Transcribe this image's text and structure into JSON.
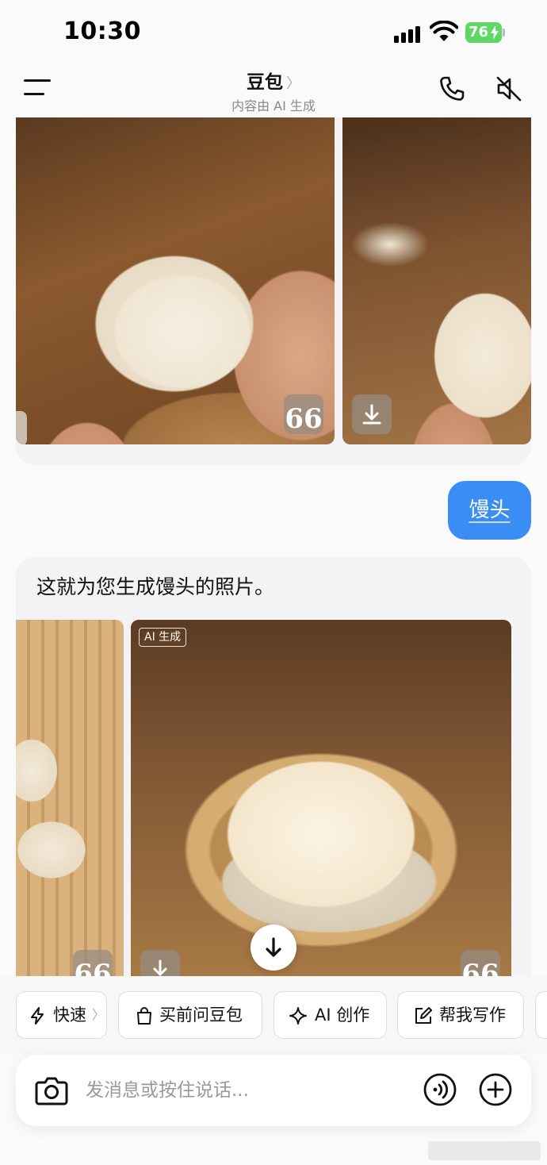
{
  "status_bar": {
    "time": "10:30",
    "battery": "76",
    "icons": [
      "cellular-signal-icon",
      "wifi-icon",
      "battery-charging-icon"
    ]
  },
  "nav": {
    "title": "豆包",
    "title_chevron": "〉",
    "subtitle": "内容由 AI 生成",
    "icons": [
      "menu-icon",
      "phone-icon",
      "speaker-mute-icon"
    ]
  },
  "messages": [
    {
      "role": "assistant",
      "images": [
        {
          "name": "bun-split-open-photo",
          "button_icon": "quote-icon",
          "button_glyph": "66"
        },
        {
          "name": "bun-held-steamer-photo",
          "button_icon": "download-icon"
        }
      ]
    },
    {
      "role": "user",
      "text": "馒头"
    },
    {
      "role": "assistant",
      "text": "这就为您生成馒头的照片。",
      "badge": "AI 生成",
      "images": [
        {
          "name": "steamer-buns-photo",
          "button_glyph": "66"
        },
        {
          "name": "steamed-bun-photo",
          "button_glyph": "66",
          "button_icon": "download-icon"
        }
      ]
    }
  ],
  "quick_actions": [
    {
      "label": "快速",
      "icon": "lightning-icon",
      "chevron": "〉"
    },
    {
      "label": "买前问豆包",
      "icon": "shopping-bag-icon"
    },
    {
      "label": "AI 创作",
      "icon": "sparkle-icon"
    },
    {
      "label": "帮我写作",
      "icon": "edit-icon"
    }
  ],
  "composer": {
    "placeholder": "发消息或按住说话...",
    "icons": [
      "camera-icon",
      "voice-call-icon",
      "plus-icon"
    ]
  },
  "colors": {
    "accent": "#3a8df5",
    "battery": "#5dd864",
    "background": "#fafafa",
    "bubble": "#f3f3f5"
  }
}
